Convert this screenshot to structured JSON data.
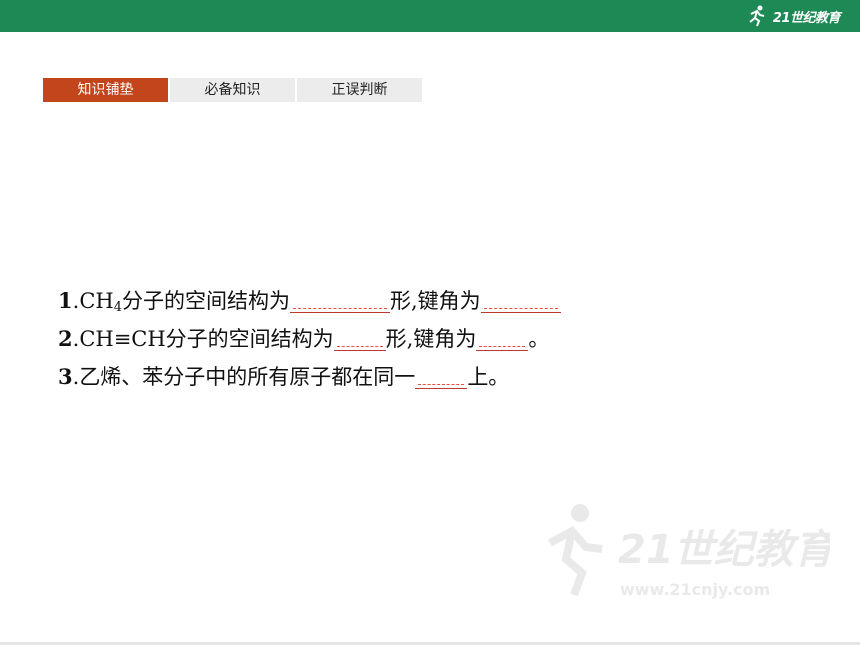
{
  "header": {
    "logo_text": "21世纪教育"
  },
  "tabs": [
    {
      "label": "知识铺垫",
      "active": true
    },
    {
      "label": "必备知识",
      "active": false
    },
    {
      "label": "正误判断",
      "active": false
    }
  ],
  "questions": [
    {
      "number": "1",
      "sep": ".",
      "parts": {
        "a": "CH",
        "sub": "4",
        "b": "分子的空间结构为",
        "c": "形,键角为",
        "d": ""
      }
    },
    {
      "number": "2",
      "sep": ".",
      "parts": {
        "a": "CH≡CH分子的空间结构为",
        "c": "形,键角为",
        "d": "。"
      }
    },
    {
      "number": "3",
      "sep": ".",
      "parts": {
        "a": "乙烯、苯分子中的所有原子都在同一",
        "d": "上。"
      }
    }
  ],
  "watermark": {
    "text": "21世纪教育",
    "url_text": "www.21cnjy.com"
  },
  "colors": {
    "header_green": "#1d8a55",
    "tab_active": "#c2451c",
    "blank_underline": "#c0392b"
  }
}
